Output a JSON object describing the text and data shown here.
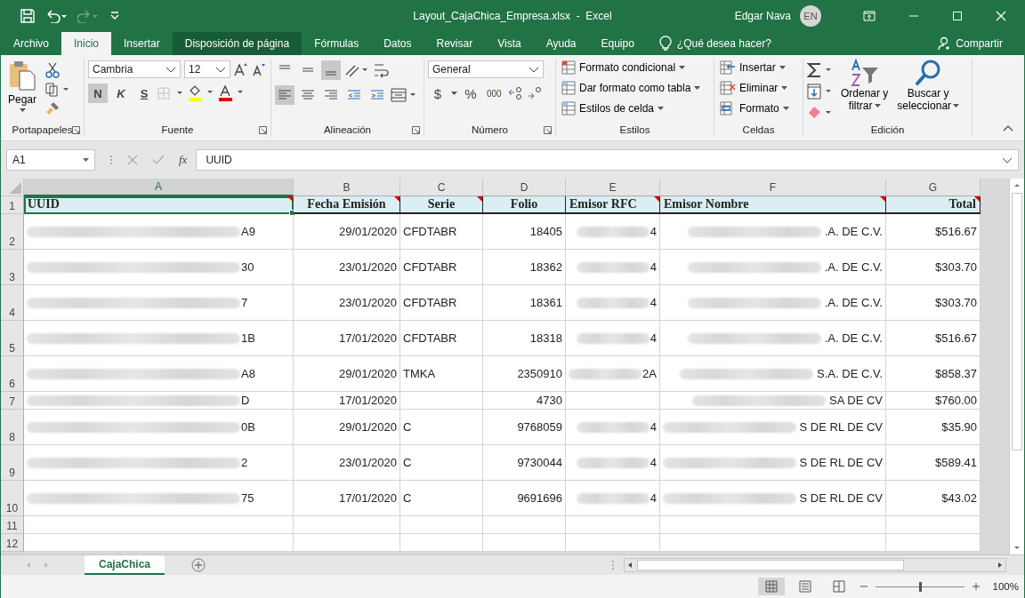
{
  "title_bar": {
    "title": "Layout_CajaChica_Empresa.xlsx  -  Excel",
    "user": "Edgar Nava",
    "initials": "EN"
  },
  "ribbon_tabs": [
    {
      "label": "Archivo",
      "selected": false,
      "hovered": false
    },
    {
      "label": "Inicio",
      "selected": true,
      "hovered": false
    },
    {
      "label": "Insertar",
      "selected": false,
      "hovered": false
    },
    {
      "label": "Disposición de página",
      "selected": false,
      "hovered": true
    },
    {
      "label": "Fórmulas",
      "selected": false,
      "hovered": false
    },
    {
      "label": "Datos",
      "selected": false,
      "hovered": false
    },
    {
      "label": "Revisar",
      "selected": false,
      "hovered": false
    },
    {
      "label": "Vista",
      "selected": false,
      "hovered": false
    },
    {
      "label": "Ayuda",
      "selected": false,
      "hovered": false
    },
    {
      "label": "Equipo",
      "selected": false,
      "hovered": false
    }
  ],
  "tell_me": "¿Qué desea hacer?",
  "share": "Compartir",
  "ribbon": {
    "paste": "Pegar",
    "font": "Cambria",
    "font_size": "12",
    "bold": "N",
    "italic": "K",
    "underline": "S",
    "number_format": "General",
    "currency": "$",
    "percent": "%",
    "thousands": "000",
    "styles": [
      "Formato condicional",
      "Dar formato como tabla",
      "Estilos de celda"
    ],
    "cells": [
      "Insertar",
      "Eliminar",
      "Formato"
    ],
    "sort": [
      "Ordenar y",
      "filtrar"
    ],
    "find": [
      "Buscar y",
      "seleccionar"
    ],
    "groups": [
      "Portapapeles",
      "Fuente",
      "Alineación",
      "Número",
      "Estilos",
      "Celdas",
      "Edición"
    ]
  },
  "formula_bar": {
    "name_box": "A1",
    "fx": "fx",
    "value": "UUID"
  },
  "columns": [
    {
      "letter": "A",
      "header": "UUID",
      "comment": true,
      "selected": true
    },
    {
      "letter": "B",
      "header": "Fecha Emisión",
      "comment": true,
      "selected": false
    },
    {
      "letter": "C",
      "header": "Serie",
      "comment": true,
      "selected": false
    },
    {
      "letter": "D",
      "header": "Folio",
      "comment": false,
      "selected": false
    },
    {
      "letter": "E",
      "header": "Emisor RFC",
      "comment": true,
      "selected": false
    },
    {
      "letter": "F",
      "header": "Emisor Nombre",
      "comment": true,
      "selected": false
    },
    {
      "letter": "G",
      "header": "Total",
      "comment": true,
      "selected": false
    }
  ],
  "header_row_num": "1",
  "rows": [
    {
      "num": "2",
      "uuid": "A9",
      "date": "29/01/2020",
      "serie": "CFDTABR",
      "folio": "18405",
      "rfc": "4",
      "name": ".A. DE C.V.",
      "total": "$516.67"
    },
    {
      "num": "3",
      "uuid": "30",
      "date": "23/01/2020",
      "serie": "CFDTABR",
      "folio": "18362",
      "rfc": "4",
      "name": ".A. DE C.V.",
      "total": "$303.70"
    },
    {
      "num": "4",
      "uuid": "7",
      "date": "23/01/2020",
      "serie": "CFDTABR",
      "folio": "18361",
      "rfc": "4",
      "name": ".A. DE C.V.",
      "total": "$303.70"
    },
    {
      "num": "5",
      "uuid": "1B",
      "date": "17/01/2020",
      "serie": "CFDTABR",
      "folio": "18318",
      "rfc": "4",
      "name": ".A. DE C.V.",
      "total": "$516.67"
    },
    {
      "num": "6",
      "uuid": "A8",
      "date": "29/01/2020",
      "serie": "TMKA",
      "folio": "2350910",
      "rfc": "2A",
      "name": "S.A. DE C.V.",
      "total": "$858.37"
    },
    {
      "num": "7",
      "uuid": "D",
      "date": "17/01/2020",
      "serie": "",
      "folio": "4730",
      "rfc": "",
      "name": "SA DE CV",
      "total": "$760.00"
    },
    {
      "num": "8",
      "uuid": "0B",
      "date": "29/01/2020",
      "serie": "C",
      "folio": "9768059",
      "rfc": "4",
      "name": "S DE RL DE CV",
      "total": "$35.90"
    },
    {
      "num": "9",
      "uuid": "2",
      "date": "23/01/2020",
      "serie": "C",
      "folio": "9730044",
      "rfc": "4",
      "name": "S DE RL DE CV",
      "total": "$589.41"
    },
    {
      "num": "10",
      "uuid": "75",
      "date": "17/01/2020",
      "serie": "C",
      "folio": "9691696",
      "rfc": "4",
      "name": "S DE RL DE CV",
      "total": "$43.02"
    }
  ],
  "empty_rows": [
    "11",
    "12"
  ],
  "sheet_tabs": [
    {
      "label": "CajaChica",
      "selected": true
    }
  ],
  "status_bar": {
    "zoom": "100%",
    "level": 0.5
  }
}
